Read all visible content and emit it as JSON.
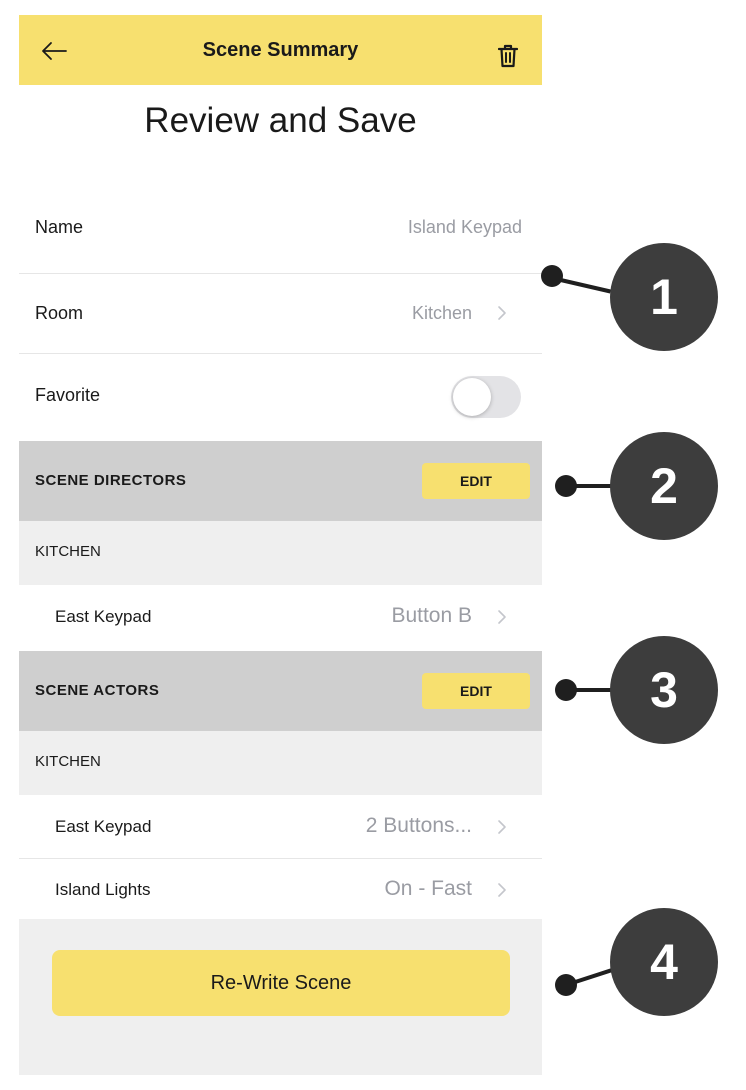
{
  "header": {
    "back_icon": "arrow-left-icon",
    "title": "Scene Summary",
    "trash_icon": "trash-icon"
  },
  "page_title": "Review and Save",
  "details": {
    "name_label": "Name",
    "name_value": "Island Keypad",
    "room_label": "Room",
    "room_value": "Kitchen",
    "favorite_label": "Favorite",
    "favorite_on": false
  },
  "directors": {
    "title": "SCENE DIRECTORS",
    "edit_label": "EDIT",
    "group": "KITCHEN",
    "items": [
      {
        "label": "East Keypad",
        "value": "Button B"
      }
    ]
  },
  "actors": {
    "title": "SCENE ACTORS",
    "edit_label": "EDIT",
    "group": "KITCHEN",
    "items": [
      {
        "label": "East Keypad",
        "value": "2 Buttons..."
      },
      {
        "label": "Island Lights",
        "value": "On - Fast"
      }
    ]
  },
  "footer": {
    "rewrite_label": "Re-Write Scene"
  },
  "callouts": [
    "1",
    "2",
    "3",
    "4"
  ],
  "colors": {
    "accent_yellow": "#f7e06f",
    "section_gray": "#cfcfcf",
    "group_gray": "#efefef",
    "value_gray": "#9a9ca3",
    "callout_dark": "#3d3d3d"
  }
}
